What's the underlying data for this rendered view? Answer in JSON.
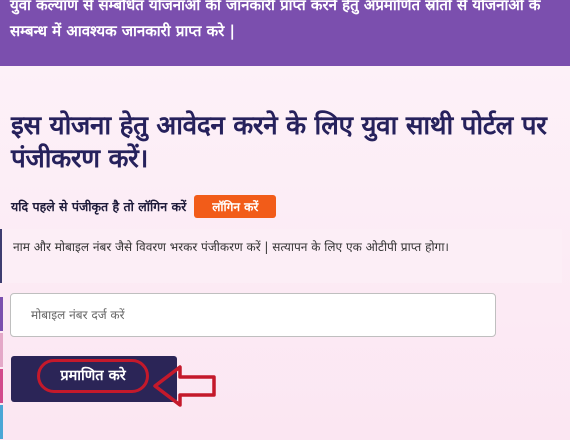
{
  "banner": {
    "text": "युवा कल्याण से सम्बंधित योजनाओ की जानकारी प्राप्त करने हेतु अप्रमाणित स्रोतों से योजनाओ के सम्बन्ध में आवश्यक जानकारी प्राप्त करे |"
  },
  "main": {
    "heading": "इस योजना हेतु आवेदन करने के लिए युवा साथी पोर्टल पर पंजीकरण करें।",
    "login_prompt": "यदि पहले से पंजीकृत है तो लॉगिन करें",
    "login_button": "लॉगिन करें",
    "info_text": "नाम और मोबाइल नंबर जैसे विवरण भरकर पंजीकरण करें | सत्यापन के लिए एक ओटीपी प्राप्त होगा।",
    "mobile_input": {
      "placeholder": "मोबाइल नंबर दर्ज करें",
      "value": ""
    },
    "verify_button": "प्रमाणित करे"
  },
  "colors": {
    "banner": "#7b4fae",
    "heading": "#26215c",
    "login_button": "#f25c19",
    "verify_button": "#2b2557",
    "annotation": "#c4192b",
    "side_strip": [
      "#7b4fae",
      "#e4a8c8",
      "#d24a8c",
      "#4aa6d6"
    ]
  }
}
